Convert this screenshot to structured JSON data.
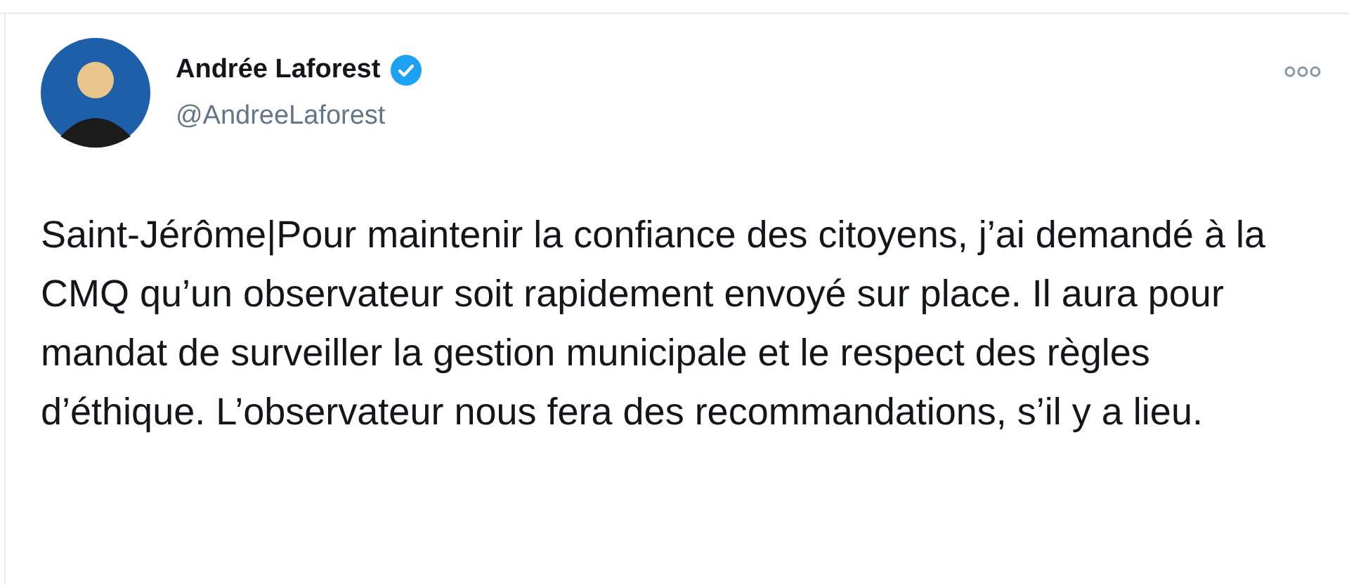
{
  "tweet": {
    "author": {
      "name": "Andrée Laforest",
      "verified": true,
      "handle": "@AndreeLaforest"
    },
    "text": "Saint-Jérôme|Pour maintenir la confiance des citoyens, j’ai demandé à la CMQ qu’un observateur soit rapidement envoyé sur place. Il aura pour mandat de surveiller la gestion municipale et le respect des règles d’éthique. L’observateur nous fera des recommandations, s’il y a lieu."
  }
}
